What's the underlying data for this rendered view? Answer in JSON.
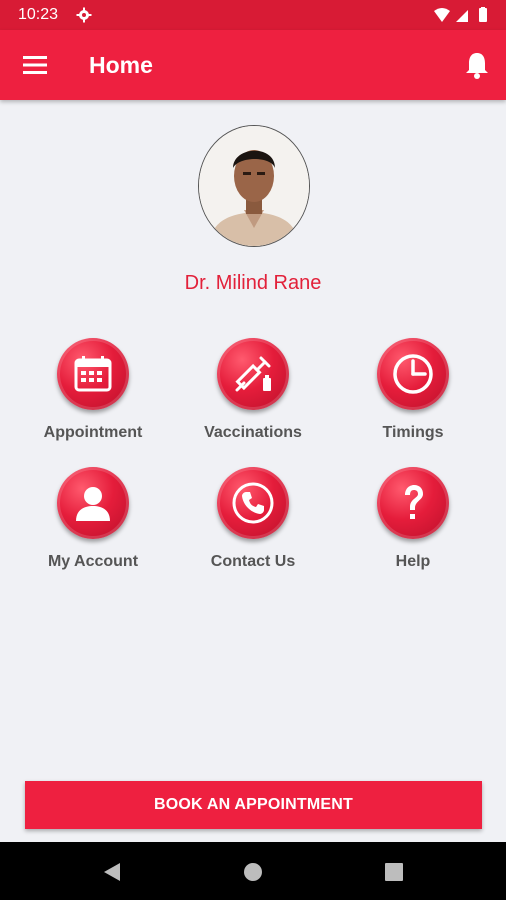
{
  "status_bar": {
    "time": "10:23"
  },
  "app_bar": {
    "title": "Home"
  },
  "profile": {
    "name": "Dr. Milind Rane"
  },
  "menu_tiles": [
    {
      "label": "Appointment",
      "icon": "calendar-icon"
    },
    {
      "label": "Vaccinations",
      "icon": "syringe-icon"
    },
    {
      "label": "Timings",
      "icon": "clock-icon"
    },
    {
      "label": "My Account",
      "icon": "user-icon"
    },
    {
      "label": "Contact Us",
      "icon": "phone-icon"
    },
    {
      "label": "Help",
      "icon": "question-icon"
    }
  ],
  "cta": {
    "label": "BOOK AN APPOINTMENT"
  },
  "colors": {
    "primary": "#ee2040",
    "status_bar": "#d81b35",
    "accent_text": "#e2213a",
    "background": "#f0f1f5"
  }
}
